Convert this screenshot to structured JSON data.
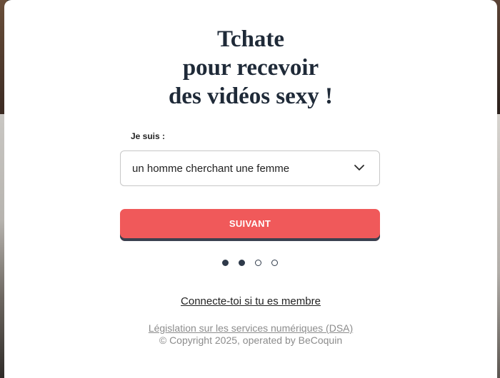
{
  "headline": {
    "line1": "Tchate",
    "line2": "pour recevoir",
    "line3": "des vidéos sexy !"
  },
  "form": {
    "label": "Je suis :",
    "selected_value": "un homme cherchant une femme",
    "next_label": "SUIVANT"
  },
  "stepper": {
    "total_steps": 4,
    "current_step": 2
  },
  "footer": {
    "login_link": "Connecte-toi si tu es membre",
    "legal_link": "Législation sur les services numériques (DSA)",
    "copyright": "© Copyright 2025, operated by BeCoquin"
  },
  "colors": {
    "accent": "#f0595a",
    "dark": "#2f3a4a",
    "muted_text": "#8c8c8c"
  },
  "icons": {
    "dropdown": "chevron-down-icon"
  }
}
